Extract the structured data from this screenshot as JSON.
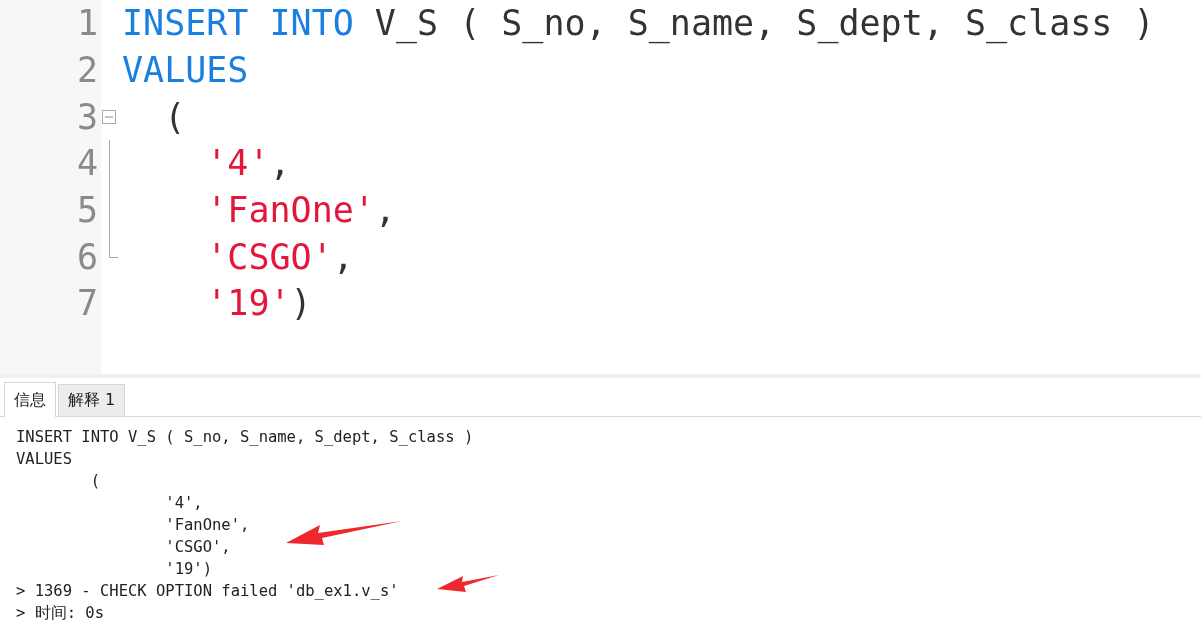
{
  "editor": {
    "lines": [
      {
        "number": "1",
        "kind": "top",
        "tokens": [
          {
            "kind": "keyword",
            "text": "INSERT INTO"
          },
          {
            "kind": "plain",
            "text": " V_S ( S_no, S_name, S_dept, S_class )"
          }
        ]
      },
      {
        "number": "2",
        "kind": "top",
        "tokens": [
          {
            "kind": "keyword",
            "text": "VALUES"
          }
        ]
      },
      {
        "number": "3",
        "kind": "open",
        "tokens": [
          {
            "kind": "plain",
            "text": "("
          }
        ]
      },
      {
        "number": "4",
        "kind": "item",
        "tokens": [
          {
            "kind": "string",
            "text": "'4'"
          },
          {
            "kind": "plain",
            "text": ","
          }
        ]
      },
      {
        "number": "5",
        "kind": "item",
        "tokens": [
          {
            "kind": "string",
            "text": "'FanOne'"
          },
          {
            "kind": "plain",
            "text": ","
          }
        ]
      },
      {
        "number": "6",
        "kind": "item_last",
        "tokens": [
          {
            "kind": "string",
            "text": "'CSGO'"
          },
          {
            "kind": "plain",
            "text": ","
          }
        ]
      },
      {
        "number": "7",
        "kind": "close",
        "tokens": [
          {
            "kind": "string",
            "text": "'19'"
          },
          {
            "kind": "plain",
            "text": ")"
          }
        ]
      }
    ]
  },
  "tabs": [
    {
      "label": "信息",
      "selected": true
    },
    {
      "label": "解释 1",
      "selected": false
    }
  ],
  "output": {
    "lines": [
      "INSERT INTO V_S ( S_no, S_name, S_dept, S_class )",
      "VALUES",
      "        (",
      "                '4',",
      "                'FanOne',",
      "                'CSGO',",
      "                '19')",
      "> 1369 - CHECK OPTION failed 'db_ex1.v_s'",
      "> 时间: 0s"
    ]
  }
}
